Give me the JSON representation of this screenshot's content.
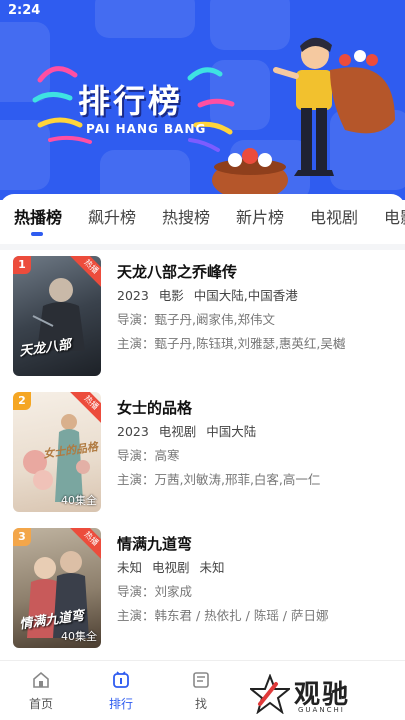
{
  "status_bar": {
    "time": "2:24"
  },
  "banner": {
    "title": "排行榜",
    "subtitle": "PAI HANG BANG",
    "bg_color": "#2f5cf0"
  },
  "tabs": [
    {
      "label": "热播榜",
      "active": true
    },
    {
      "label": "飙升榜",
      "active": false
    },
    {
      "label": "热搜榜",
      "active": false
    },
    {
      "label": "新片榜",
      "active": false
    },
    {
      "label": "电视剧",
      "active": false
    },
    {
      "label": "电影",
      "active": false
    }
  ],
  "items": [
    {
      "rank": "1",
      "rank_color": "#ec4c3c",
      "badge": "热播",
      "poster_text": "天龙八部",
      "episodes": "",
      "title": "天龙八部之乔峰传",
      "year": "2023",
      "type": "电影",
      "region": "中国大陆,中国香港",
      "director": "导演：甄子丹,阚家伟,郑伟文",
      "cast": "主演：甄子丹,陈钰琪,刘雅瑟,惠英红,吴樾"
    },
    {
      "rank": "2",
      "rank_color": "#f5a623",
      "badge": "热播",
      "poster_text": "女士的品格",
      "episodes": "40集全",
      "title": "女士的品格",
      "year": "2023",
      "type": "电视剧",
      "region": "中国大陆",
      "director": "导演：高寒",
      "cast": "主演：万茜,刘敏涛,邢菲,白客,高一仁"
    },
    {
      "rank": "3",
      "rank_color": "#f3a64a",
      "badge": "热播",
      "poster_text": "情满九道弯",
      "episodes": "40集全",
      "title": "情满九道弯",
      "year": "未知",
      "type": "电视剧",
      "region": "未知",
      "director": "导演：刘家成",
      "cast": "主演：韩东君 / 热依扎 / 陈瑶 / 萨日娜"
    }
  ],
  "bottom_nav": [
    {
      "label": "首页",
      "icon": "home-icon",
      "active": false
    },
    {
      "label": "排行",
      "icon": "ranking-icon",
      "active": true
    },
    {
      "label": "找",
      "icon": "find-icon",
      "active": false
    }
  ],
  "watermark": {
    "text": "观驰",
    "sub": "GUANCHI"
  }
}
